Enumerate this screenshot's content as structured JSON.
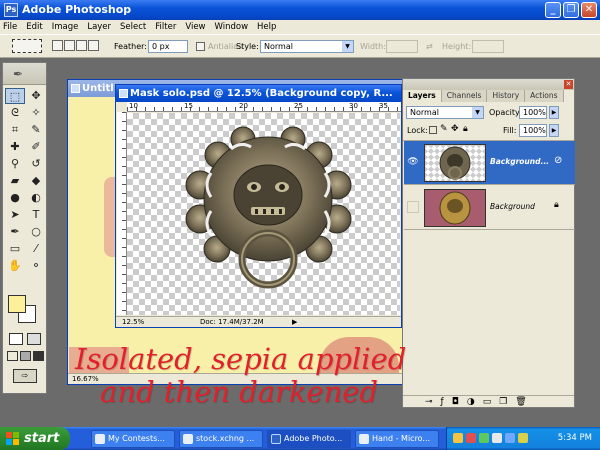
{
  "app": {
    "title": "Adobe Photoshop"
  },
  "menu": [
    "File",
    "Edit",
    "Image",
    "Layer",
    "Select",
    "Filter",
    "View",
    "Window",
    "Help"
  ],
  "options": {
    "feather_label": "Feather:",
    "feather_value": "0 px",
    "antialias_label": "Antialias",
    "style_label": "Style:",
    "style_value": "Normal",
    "width_label": "Width:",
    "height_label": "Height:"
  },
  "background_doc": {
    "title": "Untitl",
    "zoom": "16.67%"
  },
  "doc": {
    "title": "Mask solo.psd @ 12.5% (Background copy, R...",
    "zoom": "12.5%",
    "doc_info": "Doc: 17.4M/37.2M",
    "ruler_labels": [
      "10",
      "15",
      "20",
      "25",
      "30",
      "35"
    ]
  },
  "layers_panel": {
    "tabs": [
      "Layers",
      "Channels",
      "History",
      "Actions"
    ],
    "blend_mode": "Normal",
    "opacity_label": "Opacity:",
    "opacity_value": "100%",
    "lock_label": "Lock:",
    "fill_label": "Fill:",
    "fill_value": "100%",
    "layers": [
      {
        "name": "Background...",
        "selected": true
      },
      {
        "name": "Background",
        "selected": false
      }
    ]
  },
  "caption": {
    "line1": "Isolated, sepia applied",
    "line2": "and then darkened"
  },
  "taskbar": {
    "start": "start",
    "tasks": [
      "My Contests...",
      "stock.xchng ...",
      "Adobe Photo...",
      "Hand - Micro..."
    ],
    "clock": "5:34 PM"
  }
}
